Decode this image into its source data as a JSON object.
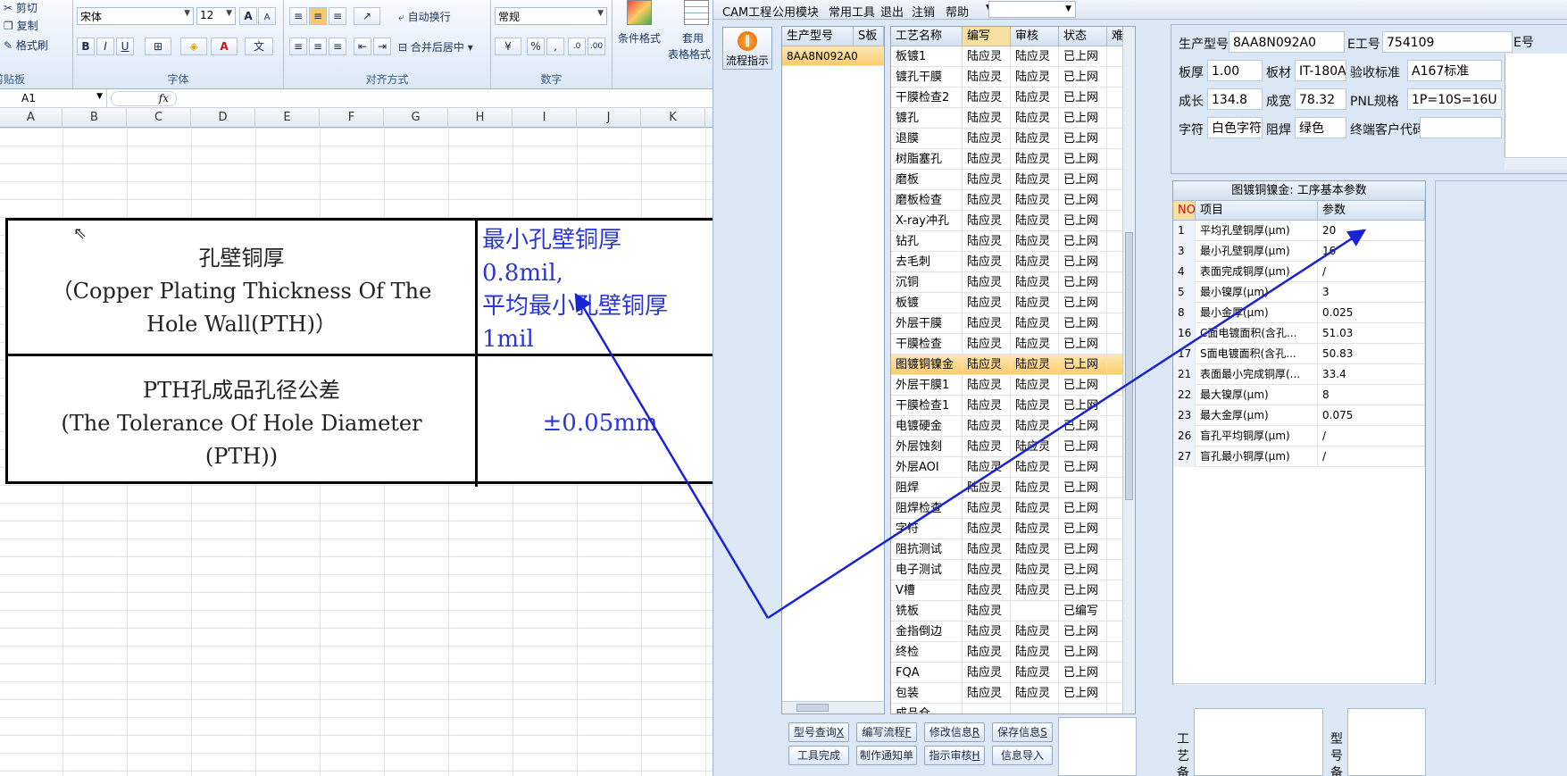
{
  "excel": {
    "ribbon": {
      "clipboard": {
        "cut": "剪切",
        "copy": "复制",
        "format_painter": "格式刷",
        "label": "剪贴板"
      },
      "font": {
        "name": "宋体",
        "size": "12",
        "label": "字体",
        "bold": "B",
        "italic": "I",
        "underline": "U"
      },
      "alignment": {
        "wrap": "自动换行",
        "merge": "合并后居中",
        "label": "对齐方式"
      },
      "number": {
        "format": "常规",
        "percent": "%",
        "comma": ",",
        "label": "数字"
      },
      "styles": {
        "conditional": "条件格式",
        "table": "套用",
        "table2": "表格格式"
      }
    },
    "name_box": "A1",
    "fx": "fx",
    "columns": [
      "A",
      "B",
      "C",
      "D",
      "E",
      "F",
      "G",
      "H",
      "I",
      "J",
      "K"
    ],
    "table": {
      "r1_left_line1": "孔壁铜厚",
      "r1_left_line2": "（Copper Plating Thickness Of The",
      "r1_left_line3": "Hole Wall(PTH)）",
      "r1_right_line1": "最小孔壁铜厚",
      "r1_right_line2": "0.8mil,",
      "r1_right_line3": "平均最小孔壁铜厚",
      "r1_right_line4": "1mil",
      "r2_left_line1": "PTH孔成品孔径公差",
      "r2_left_line2": "(The Tolerance Of Hole Diameter",
      "r2_left_line3": "(PTH))",
      "r2_right": "±0.05mm"
    }
  },
  "cam": {
    "menu": [
      "CAM工程",
      "公用模块",
      "常用工具",
      "退出",
      "注销",
      "帮助"
    ],
    "flow_button": "流程指示",
    "model_list": {
      "headers": [
        "生产型号",
        "S板"
      ],
      "rows": [
        "8AA8N092A0"
      ]
    },
    "process": {
      "headers": [
        "工艺名称",
        "编写",
        "审核",
        "状态",
        "难度"
      ],
      "rows": [
        [
          "板镀1",
          "陆应灵",
          "陆应灵",
          "已上网"
        ],
        [
          "镀孔干膜",
          "陆应灵",
          "陆应灵",
          "已上网"
        ],
        [
          "干膜检查2",
          "陆应灵",
          "陆应灵",
          "已上网"
        ],
        [
          "镀孔",
          "陆应灵",
          "陆应灵",
          "已上网"
        ],
        [
          "退膜",
          "陆应灵",
          "陆应灵",
          "已上网"
        ],
        [
          "树脂塞孔",
          "陆应灵",
          "陆应灵",
          "已上网"
        ],
        [
          "磨板",
          "陆应灵",
          "陆应灵",
          "已上网"
        ],
        [
          "磨板检查",
          "陆应灵",
          "陆应灵",
          "已上网"
        ],
        [
          "X-ray冲孔",
          "陆应灵",
          "陆应灵",
          "已上网"
        ],
        [
          "钻孔",
          "陆应灵",
          "陆应灵",
          "已上网"
        ],
        [
          "去毛刺",
          "陆应灵",
          "陆应灵",
          "已上网"
        ],
        [
          "沉铜",
          "陆应灵",
          "陆应灵",
          "已上网"
        ],
        [
          "板镀",
          "陆应灵",
          "陆应灵",
          "已上网"
        ],
        [
          "外层干膜",
          "陆应灵",
          "陆应灵",
          "已上网"
        ],
        [
          "干膜检查",
          "陆应灵",
          "陆应灵",
          "已上网"
        ],
        [
          "图镀铜镍金",
          "陆应灵",
          "陆应灵",
          "已上网"
        ],
        [
          "外层干膜1",
          "陆应灵",
          "陆应灵",
          "已上网"
        ],
        [
          "干膜检查1",
          "陆应灵",
          "陆应灵",
          "已上网"
        ],
        [
          "电镀硬金",
          "陆应灵",
          "陆应灵",
          "已上网"
        ],
        [
          "外层蚀刻",
          "陆应灵",
          "陆应灵",
          "已上网"
        ],
        [
          "外层AOI",
          "陆应灵",
          "陆应灵",
          "已上网"
        ],
        [
          "阻焊",
          "陆应灵",
          "陆应灵",
          "已上网"
        ],
        [
          "阻焊检查",
          "陆应灵",
          "陆应灵",
          "已上网"
        ],
        [
          "字符",
          "陆应灵",
          "陆应灵",
          "已上网"
        ],
        [
          "阻抗测试",
          "陆应灵",
          "陆应灵",
          "已上网"
        ],
        [
          "电子测试",
          "陆应灵",
          "陆应灵",
          "已上网"
        ],
        [
          "V槽",
          "陆应灵",
          "陆应灵",
          "已上网"
        ],
        [
          "铣板",
          "陆应灵",
          "",
          "已编写"
        ],
        [
          "金指倒边",
          "陆应灵",
          "陆应灵",
          "已上网"
        ],
        [
          "终检",
          "陆应灵",
          "陆应灵",
          "已上网"
        ],
        [
          "FQA",
          "陆应灵",
          "陆应灵",
          "已上网"
        ],
        [
          "包装",
          "陆应灵",
          "陆应灵",
          "已上网"
        ],
        [
          "成品仓",
          "",
          "",
          ""
        ]
      ]
    },
    "info": {
      "model_label": "生产型号",
      "model": "8AA8N092A0",
      "eno_label": "E工号",
      "eno": "754109",
      "thick_label": "板厚",
      "thick": "1.00",
      "mat_label": "板材",
      "mat": "IT-180A",
      "std_label": "验收标准",
      "std": "A167标准",
      "len_label": "成长",
      "len": "134.8",
      "wid_label": "成宽",
      "wid": "78.32",
      "pnl_label": "PNL规格",
      "pnl": "1P=10S=16U",
      "char_label": "字符",
      "char": "白色字符",
      "mask_label": "阻焊",
      "mask": "绿色",
      "cust_label": "终端客户代码",
      "cust": "",
      "extra_label": "E号"
    },
    "params": {
      "title": "图镀铜镍金: 工序基本参数",
      "headers": [
        "NO",
        "项目",
        "参数"
      ],
      "rows": [
        [
          "1",
          "平均孔壁铜厚(μm)",
          "20"
        ],
        [
          "3",
          "最小孔壁铜厚(μm)",
          "16"
        ],
        [
          "4",
          "表面完成铜厚(μm)",
          "/"
        ],
        [
          "5",
          "最小镍厚(μm)",
          "3"
        ],
        [
          "8",
          "最小金厚(μm)",
          "0.025"
        ],
        [
          "16",
          "C面电镀面积(含孔...",
          "51.03"
        ],
        [
          "17",
          "S面电镀面积(含孔...",
          "50.83"
        ],
        [
          "21",
          "表面最小完成铜厚(...",
          "33.4"
        ],
        [
          "22",
          "最大镍厚(μm)",
          "8"
        ],
        [
          "23",
          "最大金厚(μm)",
          "0.075"
        ],
        [
          "26",
          "盲孔平均铜厚(μm)",
          "/"
        ],
        [
          "27",
          "盲孔最小铜厚(μm)",
          "/"
        ]
      ]
    },
    "buttons": [
      {
        "label": "型号查询",
        "key": "X"
      },
      {
        "label": "编写流程",
        "key": "F"
      },
      {
        "label": "修改信息",
        "key": "R"
      },
      {
        "label": "保存信息",
        "key": "S"
      },
      {
        "label": "工具完成",
        "key": ""
      },
      {
        "label": "制作通知单",
        "key": ""
      },
      {
        "label": "指示审核",
        "key": "H"
      },
      {
        "label": "信息导入",
        "key": ""
      }
    ],
    "remarks": {
      "process_label": "工艺备注",
      "model_label": "型号备注"
    }
  },
  "annotation_color": "#1a22d6",
  "selection_color": "#f9cd6e"
}
